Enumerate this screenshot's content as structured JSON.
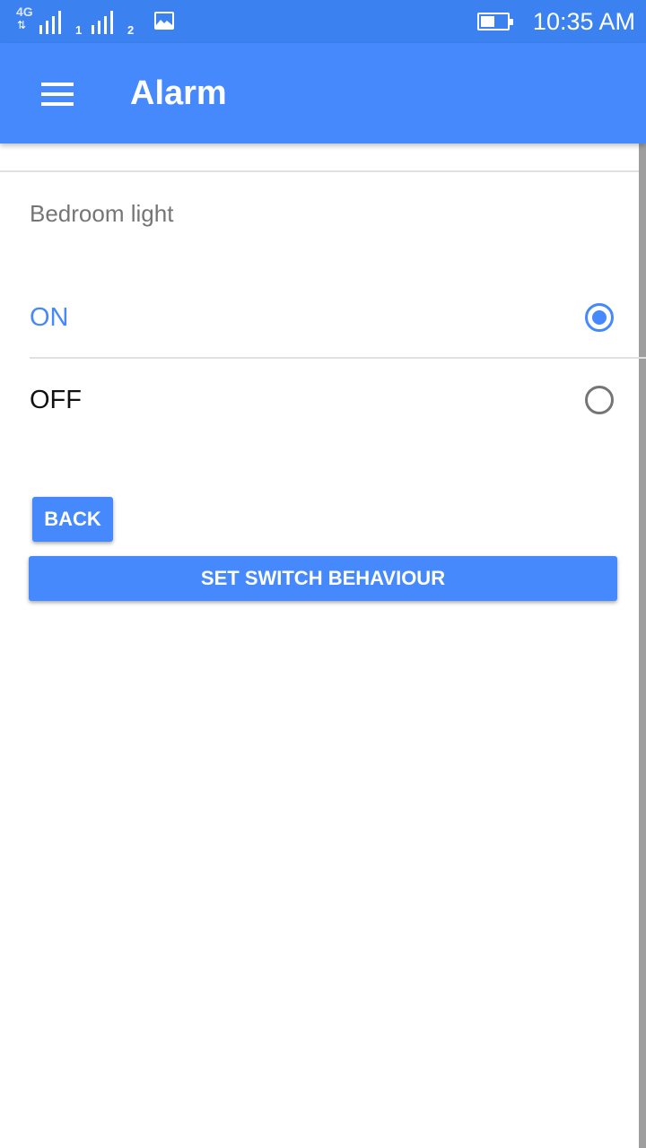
{
  "status_bar": {
    "network_type": "4G",
    "sim1_label": "1",
    "sim2_label": "2",
    "battery_level": 0.55,
    "time": "10:35 AM"
  },
  "app_bar": {
    "menu_icon": "hamburger-menu-icon",
    "title": "Alarm"
  },
  "section": {
    "device_name": "Bedroom light"
  },
  "options": [
    {
      "label": "ON",
      "selected": true
    },
    {
      "label": "OFF",
      "selected": false
    }
  ],
  "buttons": {
    "back_label": "BACK",
    "set_label": "SET SWITCH BEHAVIOUR"
  },
  "colors": {
    "status_bar": "#3b82f0",
    "accent": "#4689fc",
    "label_gray": "#757575"
  }
}
